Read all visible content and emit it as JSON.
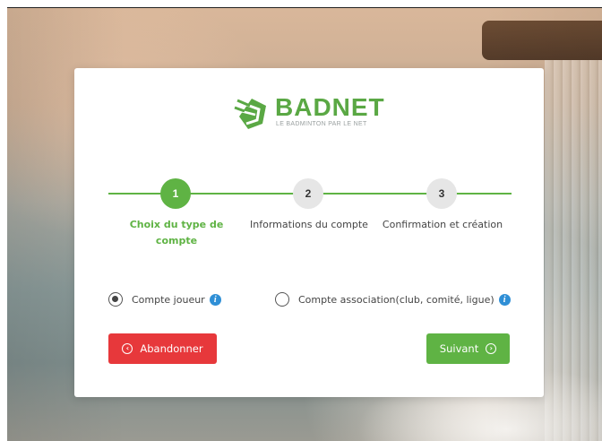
{
  "brand": {
    "name": "BADNET",
    "tagline": "LE BADMINTON PAR LE NET",
    "color": "#5aa844"
  },
  "steps": [
    {
      "number": "1",
      "label": "Choix du type de compte",
      "active": true
    },
    {
      "number": "2",
      "label": "Informations du compte",
      "active": false
    },
    {
      "number": "3",
      "label": "Confirmation et création",
      "active": false
    }
  ],
  "account_types": [
    {
      "label": "Compte joueur",
      "checked": true,
      "icon": "info-icon"
    },
    {
      "label": "Compte association(club, comité, ligue)",
      "checked": false,
      "icon": "info-icon"
    }
  ],
  "buttons": {
    "cancel_label": "Abandonner",
    "cancel_icon": "chevron-left-circle-icon",
    "cancel_color": "#e7383b",
    "next_label": "Suivant",
    "next_icon": "chevron-right-circle-icon",
    "next_color": "#5fb344"
  }
}
